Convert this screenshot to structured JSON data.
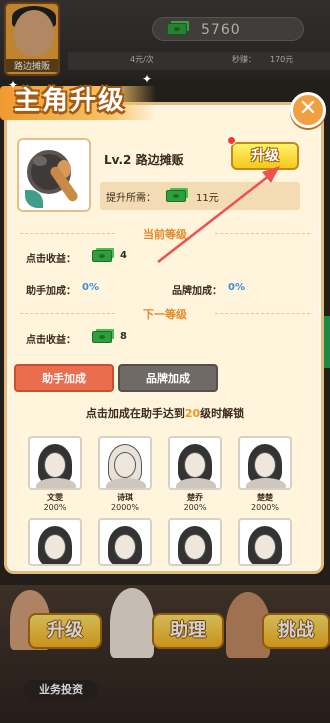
{
  "topbar": {
    "avatar_name": "路边摊贩",
    "money": "5760",
    "info_income": "4元/次",
    "info_seconds_label": "秒赚：",
    "info_seconds_value": "170元"
  },
  "side_tab": {
    "icon": "game-controller-icon"
  },
  "modal": {
    "title": "主角升级",
    "close_icon": "close-x-icon",
    "level_name": "Lv.2 路边摊贩",
    "upgrade_label": "升级",
    "cost_label": "提升所需：",
    "cost_value": "11元",
    "current_section": "当前等级",
    "click_income_label": "点击收益：",
    "current_click_income": "4",
    "helper_bonus_label": "助手加成：",
    "helper_bonus_value": "0%",
    "brand_bonus_label": "品牌加成：",
    "brand_bonus_value": "0%",
    "next_section": "下一等级",
    "next_click_income": "8",
    "tabs": [
      "助手加成",
      "品牌加成"
    ],
    "unlock_note_pre": "点击加成在助手达到",
    "unlock_note_hl": "20",
    "unlock_note_post": "级时解锁",
    "helpers": [
      {
        "name": "文雯",
        "pct": "200%"
      },
      {
        "name": "诗琪",
        "pct": "2000%"
      },
      {
        "name": "楚乔",
        "pct": "200%"
      },
      {
        "name": "楚楚",
        "pct": "2000%"
      }
    ]
  },
  "bottom": {
    "buttons": [
      "升级",
      "助理",
      "挑战"
    ],
    "invest": "业务投资"
  },
  "colors": {
    "accent_orange": "#f0971f",
    "bonus_blue": "#3a8fd6",
    "tab_active": "#ea6e4e",
    "upgrade_yellow": "#f7c81e",
    "arrow_red": "#f05050"
  }
}
